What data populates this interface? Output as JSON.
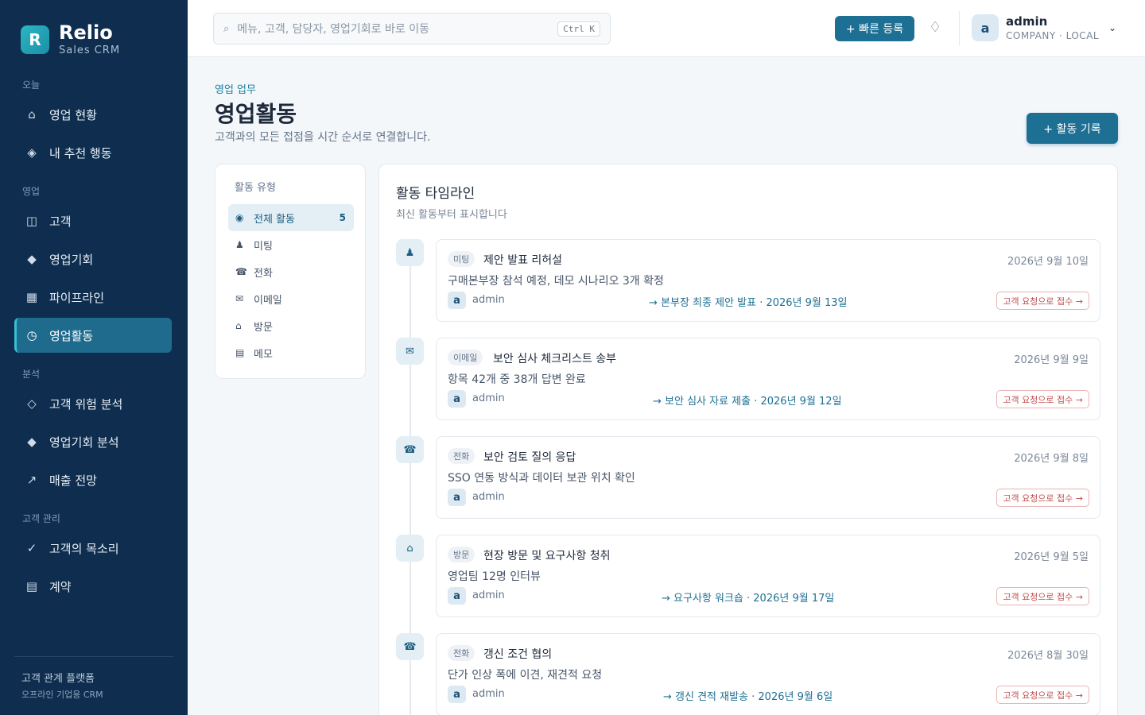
{
  "brand": {
    "logo_letter": "R",
    "name": "Relio",
    "subtitle": "Sales CRM"
  },
  "sidebar": {
    "sections": [
      {
        "label": "오늘"
      },
      {
        "label": "영업"
      },
      {
        "label": "분석"
      },
      {
        "label": "고객 관리"
      }
    ],
    "items": [
      {
        "label": "영업 현황",
        "icon": "home-icon",
        "glyph": "⌂"
      },
      {
        "label": "내 추천 행동",
        "icon": "sparkle-icon",
        "glyph": "◈"
      },
      {
        "label": "고객",
        "icon": "customers-icon",
        "glyph": "◫"
      },
      {
        "label": "영업기회",
        "icon": "diamond-icon",
        "glyph": "◆"
      },
      {
        "label": "파이프라인",
        "icon": "grid-icon",
        "glyph": "▦"
      },
      {
        "label": "영업활동",
        "icon": "clock-icon",
        "glyph": "◷",
        "active": true
      },
      {
        "label": "고객 위험 분석",
        "icon": "risk-icon",
        "glyph": "◇"
      },
      {
        "label": "영업기회 분석",
        "icon": "analysis-icon",
        "glyph": "◆"
      },
      {
        "label": "매출 전망",
        "icon": "trend-icon",
        "glyph": "↗"
      },
      {
        "label": "고객의 목소리",
        "icon": "check-icon",
        "glyph": "✓"
      },
      {
        "label": "계약",
        "icon": "document-icon",
        "glyph": "▤"
      }
    ],
    "footer": {
      "line1": "고객 관계 플랫폼",
      "line2": "오프라인 기업용 CRM"
    }
  },
  "topbar": {
    "search": {
      "icon": "search-icon",
      "glyph": "⌕",
      "placeholder": "메뉴, 고객, 담당자, 영업기회로 바로 이동",
      "shortcut": "Ctrl K"
    },
    "quick_add_label": "+ 빠른 등록",
    "notification_icon": "♢",
    "user": {
      "initial": "a",
      "name": "admin",
      "org": "COMPANY · LOCAL",
      "chevron": "⌄"
    }
  },
  "page": {
    "eyebrow": "영업 업무",
    "title": "영업활동",
    "description": "고객과의 모든 접점을 시간 순서로 연결합니다.",
    "add_button": "+ 활동 기록"
  },
  "filters": {
    "title": "활동 유형",
    "items": [
      {
        "label": "전체 활동",
        "glyph": "◉",
        "count": "5",
        "active": true
      },
      {
        "label": "미팅",
        "glyph": "♟"
      },
      {
        "label": "전화",
        "glyph": "☎"
      },
      {
        "label": "이메일",
        "glyph": "✉"
      },
      {
        "label": "방문",
        "glyph": "⌂"
      },
      {
        "label": "메모",
        "glyph": "▤"
      }
    ]
  },
  "timeline": {
    "title": "활동 타임라인",
    "subtitle": "최신 활동부터 표시합니다",
    "activities": [
      {
        "type": "미팅",
        "glyph": "♟",
        "title": "제안 발표 리허설",
        "date": "2026년 9월 10일",
        "desc": "구매본부장 참석 예정, 데모 시나리오 3개 확정",
        "owner_initial": "a",
        "owner": "admin",
        "next": "→ 본부장 최종 제안 발표 · 2026년 9월 13일",
        "cta": "고객 요청으로 접수 →"
      },
      {
        "type": "이메일",
        "glyph": "✉",
        "title": "보안 심사 체크리스트 송부",
        "date": "2026년 9월 9일",
        "desc": "항목 42개 중 38개 답변 완료",
        "owner_initial": "a",
        "owner": "admin",
        "next": "→ 보안 심사 자료 제출 · 2026년 9월 12일",
        "cta": "고객 요청으로 접수 →"
      },
      {
        "type": "전화",
        "glyph": "☎",
        "title": "보안 검토 질의 응답",
        "date": "2026년 9월 8일",
        "desc": "SSO 연동 방식과 데이터 보관 위치 확인",
        "owner_initial": "a",
        "owner": "admin",
        "next": "",
        "cta": "고객 요청으로 접수 →"
      },
      {
        "type": "방문",
        "glyph": "⌂",
        "title": "현장 방문 및 요구사항 청취",
        "date": "2026년 9월 5일",
        "desc": "영업팀 12명 인터뷰",
        "owner_initial": "a",
        "owner": "admin",
        "next": "→ 요구사항 워크숍 · 2026년 9월 17일",
        "cta": "고객 요청으로 접수 →"
      },
      {
        "type": "전화",
        "glyph": "☎",
        "title": "갱신 조건 협의",
        "date": "2026년 8월 30일",
        "desc": "단가 인상 폭에 이견, 재견적 요청",
        "owner_initial": "a",
        "owner": "admin",
        "next": "→ 갱신 견적 재발송 · 2026년 9월 6일",
        "cta": "고객 요청으로 접수 →"
      }
    ]
  }
}
